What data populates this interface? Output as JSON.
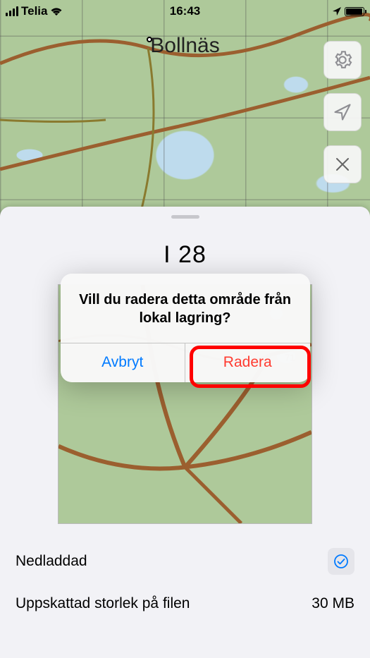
{
  "statusbar": {
    "carrier": "Telia",
    "time": "16:43"
  },
  "map": {
    "city_label": "Bollnäs"
  },
  "sheet": {
    "region_title": "I 28",
    "downloaded_label": "Nedladdad",
    "size_label": "Uppskattad storlek på filen",
    "size_value": "30 MB"
  },
  "alert": {
    "title": "Vill du radera detta område från lokal lagring?",
    "cancel": "Avbryt",
    "destructive": "Radera"
  }
}
